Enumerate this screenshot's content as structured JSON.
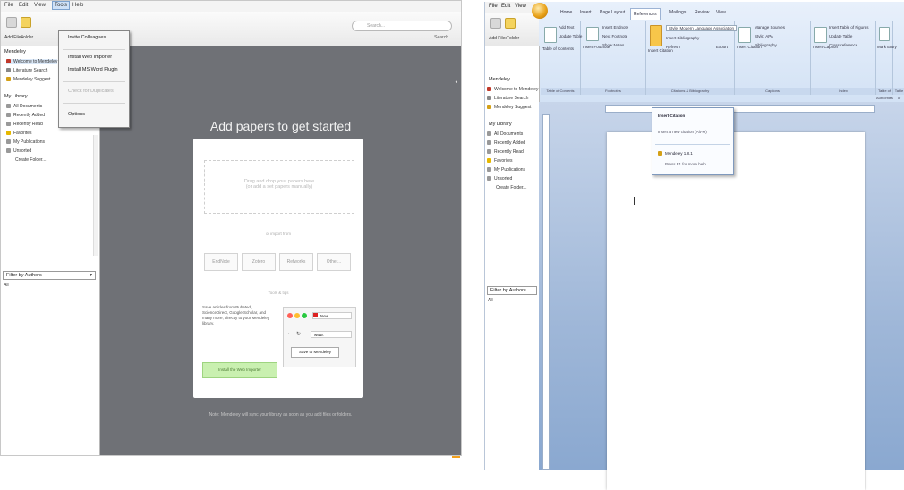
{
  "left_window": {
    "menu": [
      "File",
      "Edit",
      "View",
      "Tools",
      "Help"
    ],
    "toolbar": {
      "add_files": "Add Files",
      "folder": "Folder"
    },
    "search": {
      "placeholder": "Search...",
      "label": "Search"
    },
    "tools_menu": [
      "Invite Colleagues...",
      "Install Web Importer",
      "Install MS Word Plugin",
      "Check for Duplicates",
      "Options"
    ],
    "sidebar": {
      "app": "Mendeley",
      "mendeley_items": [
        "Welcome to Mendeley",
        "Literature Search",
        "Mendeley Suggest"
      ],
      "library_header": "My Library",
      "library_items": [
        "All Documents",
        "Recently Added",
        "Recently Read",
        "Favorites",
        "My Publications",
        "Unsorted",
        "Create Folder..."
      ],
      "filter": "Filter by Authors",
      "filter_value": "All"
    },
    "main": {
      "title": "Add papers to get started",
      "dropzone": [
        "Drag and drop your papers here",
        "(or add a set papers manually)"
      ],
      "import_from": "or import from",
      "sources": [
        "EndNote",
        "Zotero",
        "Refworks",
        "Other..."
      ],
      "tools_header": "Tools & tips",
      "tools_text": "Save articles from PubMed, ScienceDirect, Google Scholar, and many more, directly to your Mendeley library.",
      "web_importer_button": "Install the Web Importer",
      "preview_tab": "New",
      "preview_url": "www.",
      "save_to": "Save to Mendeley",
      "footer": "Note: Mendeley will sync your library as soon as you add files or folders."
    }
  },
  "right_window": {
    "menu": [
      "File",
      "Edit",
      "View"
    ],
    "toolbar": {
      "add_files": "Add Files",
      "folder": "Folder"
    },
    "ribbon_tabs": [
      "Home",
      "Insert",
      "Page Layout",
      "References",
      "Mailings",
      "Review",
      "View"
    ],
    "active_tab": "References",
    "groups": [
      "Table of Contents",
      "Footnotes",
      "Citations & Bibliography",
      "Captions",
      "Index",
      "Table of Authorities"
    ],
    "group_items": {
      "toc": [
        "Add Text",
        "Update Table",
        "Table of Contents"
      ],
      "footnotes": [
        "Insert Endnote",
        "Next Footnote",
        "Show Notes",
        "Insert Footnote"
      ],
      "citation": [
        "Style: Modern Language Association",
        "Insert Bibliography",
        "Refresh",
        "Insert Citation",
        "Export"
      ],
      "bibliography": [
        "Manage Sources",
        "Style: APA",
        "Bibliography",
        "Insert Citation"
      ],
      "captions": [
        "Insert Table of Figures",
        "Update Table",
        "Cross-reference",
        "Insert Caption"
      ],
      "index": [
        "Mark Entry"
      ]
    },
    "popup": {
      "items": [
        "Insert Citation",
        "Insert a new citation (Alt-M)",
        "Mendeley 1.8.1",
        "Press F1 for more help."
      ]
    },
    "sidebar": {
      "app": "Mendeley",
      "mendeley_items": [
        "Welcome to Mendeley",
        "Literature Search",
        "Mendeley Suggest"
      ],
      "library_header": "My Library",
      "library_items": [
        "All Documents",
        "Recently Added",
        "Recently Read",
        "Favorites",
        "My Publications",
        "Unsorted",
        "Create Folder..."
      ],
      "filter": "Filter by Authors",
      "filter_value": "All"
    }
  },
  "colors": {
    "accent": "#f2a01c",
    "main_bg": "#6f7176",
    "ribbon": "#d3e2f5",
    "green": "#c9f0b0"
  }
}
